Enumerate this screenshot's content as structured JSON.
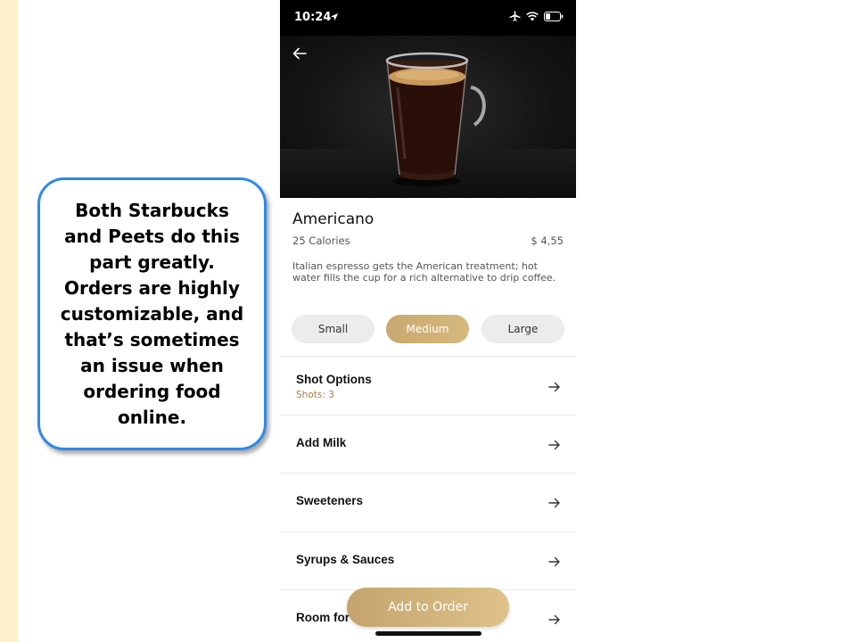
{
  "callout": {
    "text": "Both Starbucks and Peets do this part greatly. Orders are highly customizable, and that’s sometimes an issue when ordering food online."
  },
  "status_bar": {
    "time": "10:24",
    "icons": [
      "location-arrow-icon",
      "airplane-icon",
      "wifi-icon",
      "battery-icon"
    ]
  },
  "product": {
    "name": "Americano",
    "calories": "25 Calories",
    "price": "$ 4,55",
    "description": "Italian espresso gets the American treatment; hot water fills the cup for a rich alternative to drip coffee."
  },
  "sizes": [
    {
      "label": "Small",
      "selected": false
    },
    {
      "label": "Medium",
      "selected": true
    },
    {
      "label": "Large",
      "selected": false
    }
  ],
  "options": [
    {
      "label": "Shot Options",
      "sub": "Shots: 3"
    },
    {
      "label": "Add Milk",
      "sub": ""
    },
    {
      "label": "Sweeteners",
      "sub": ""
    },
    {
      "label": "Syrups & Sauces",
      "sub": ""
    },
    {
      "label": "Room for",
      "sub": ""
    }
  ],
  "add_button": {
    "label": "Add to Order"
  },
  "colors": {
    "accent_gold": "#c8a86e",
    "callout_border": "#2f8ae6",
    "left_strip": "#fdf1cc",
    "option_sub": "#a07f4a"
  }
}
